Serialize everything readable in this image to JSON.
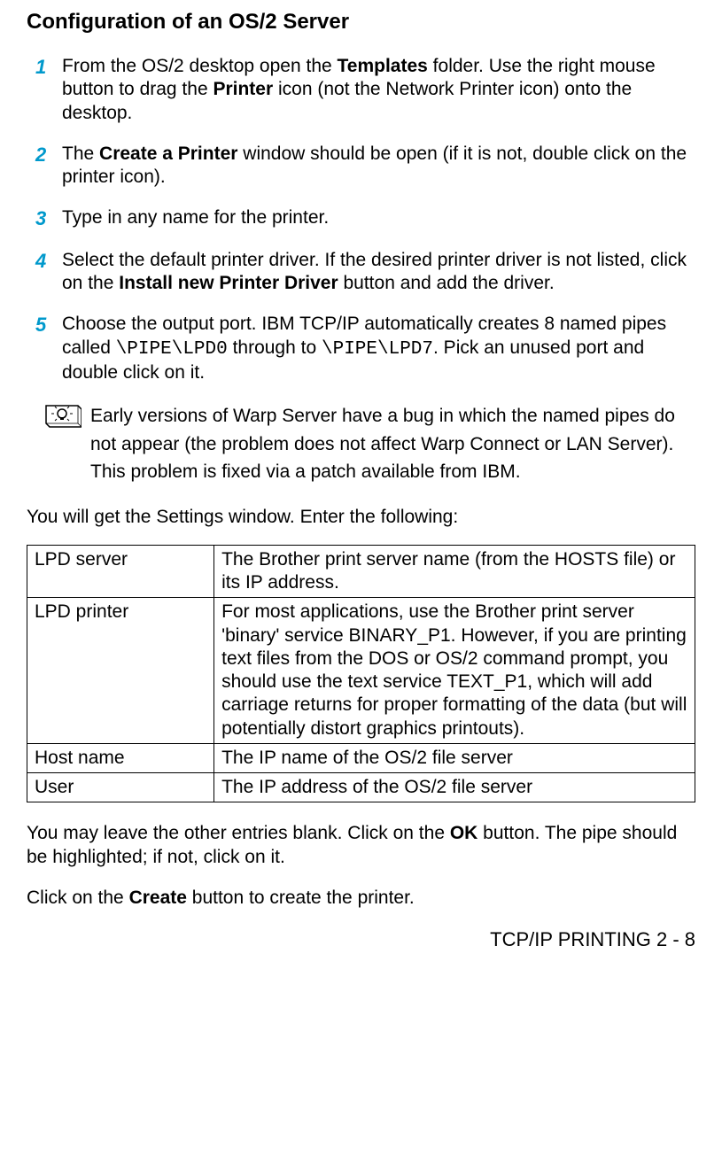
{
  "heading": "Configuration of an OS/2 Server",
  "steps": [
    {
      "num": "1",
      "segments": [
        {
          "text": "From the OS/2 desktop open the "
        },
        {
          "text": "Templates",
          "bold": true
        },
        {
          "text": " folder. Use the right mouse button to drag the "
        },
        {
          "text": "Printer",
          "bold": true
        },
        {
          "text": " icon (not the Network Printer icon) onto the desktop."
        }
      ]
    },
    {
      "num": "2",
      "segments": [
        {
          "text": "The "
        },
        {
          "text": "Create a Printer",
          "bold": true
        },
        {
          "text": " window should be open (if it is not, double click on the printer icon)."
        }
      ]
    },
    {
      "num": "3",
      "segments": [
        {
          "text": "Type in any name for the printer."
        }
      ]
    },
    {
      "num": "4",
      "segments": [
        {
          "text": "Select the default printer driver. If the desired printer driver is not listed, click on the "
        },
        {
          "text": "Install new Printer Driver",
          "bold": true
        },
        {
          "text": " button and add the driver."
        }
      ]
    },
    {
      "num": "5",
      "segments": [
        {
          "text": "Choose the output port. IBM TCP/IP automatically creates 8 named pipes called  "
        },
        {
          "text": "\\PIPE\\LPD0",
          "mono": true
        },
        {
          "text": " through to "
        },
        {
          "text": "\\PIPE\\LPD7",
          "mono": true
        },
        {
          "text": ". Pick an unused port and double click on it."
        }
      ]
    }
  ],
  "note": "Early versions of Warp Server have a bug in which the named pipes do not appear (the problem does not affect Warp Connect or LAN Server). This problem is fixed via a patch available from IBM.",
  "settings_intro": "You will get the Settings window. Enter the following:",
  "table": [
    {
      "label": "LPD server",
      "value": "The Brother print server name (from the HOSTS file) or its IP address."
    },
    {
      "label": "LPD printer",
      "value": "For most applications, use the Brother print server 'binary' service BINARY_P1. However, if you are printing text files from the DOS or OS/2 command prompt, you should use the text service TEXT_P1, which will add carriage returns for proper formatting of the data (but will potentially distort graphics printouts)."
    },
    {
      "label": "Host name",
      "value": "The IP name of the OS/2 file server"
    },
    {
      "label": "User",
      "value": "The IP address of the OS/2 file server"
    }
  ],
  "post_para_segments": [
    {
      "text": "You may leave the other entries blank. Click on the "
    },
    {
      "text": "OK",
      "bold": true
    },
    {
      "text": " button. The pipe should be highlighted; if not, click on it."
    }
  ],
  "create_para_segments": [
    {
      "text": "Click on the "
    },
    {
      "text": "Create",
      "bold": true
    },
    {
      "text": " button to create the printer."
    }
  ],
  "footer": "TCP/IP PRINTING 2 - 8"
}
